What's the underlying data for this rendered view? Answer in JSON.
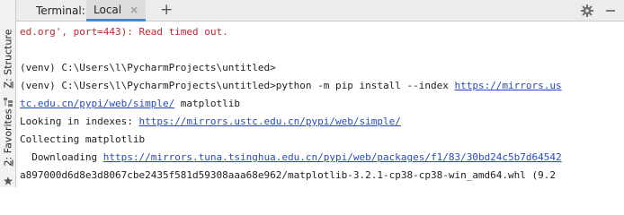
{
  "side": {
    "structure_label_key": "Z",
    "structure_label": ": Structure",
    "favorites_label_key": "2",
    "favorites_label": ": Favorites"
  },
  "header": {
    "title": "Terminal:",
    "tab_label": "Local",
    "close_glyph": "×",
    "add_glyph": "+"
  },
  "terminal": {
    "lines": [
      {
        "text": "ed.org', port=443): Read timed out.",
        "kind": "error"
      },
      {
        "text": "",
        "kind": "plain"
      },
      {
        "text": "(venv) C:\\Users\\l\\PycharmProjects\\untitled>",
        "kind": "plain"
      },
      {
        "prefix": "(venv) C:\\Users\\l\\PycharmProjects\\untitled>python -m pip install --index ",
        "link": "https://mirrors.us",
        "suffix": ""
      },
      {
        "prefix": "",
        "link": "tc.edu.cn/pypi/web/simple/",
        "suffix": " matplotlib"
      },
      {
        "prefix": "Looking in indexes: ",
        "link": "https://mirrors.ustc.edu.cn/pypi/web/simple/",
        "suffix": ""
      },
      {
        "text": "Collecting matplotlib",
        "kind": "plain"
      },
      {
        "prefix": "  Downloading ",
        "link": "https://mirrors.tuna.tsinghua.edu.cn/pypi/web/packages/f1/83/30bd24c5b7d64542",
        "suffix": ""
      },
      {
        "text": "a897000d6d8e3d8067cbe2435f581d59308aaa68e962/matplotlib-3.2.1-cp38-cp38-win_amd64.whl (9.2",
        "kind": "plain"
      }
    ]
  },
  "colors": {
    "error": "#c1272d",
    "link": "#2349c9",
    "tab_underline": "#4a88c7"
  }
}
